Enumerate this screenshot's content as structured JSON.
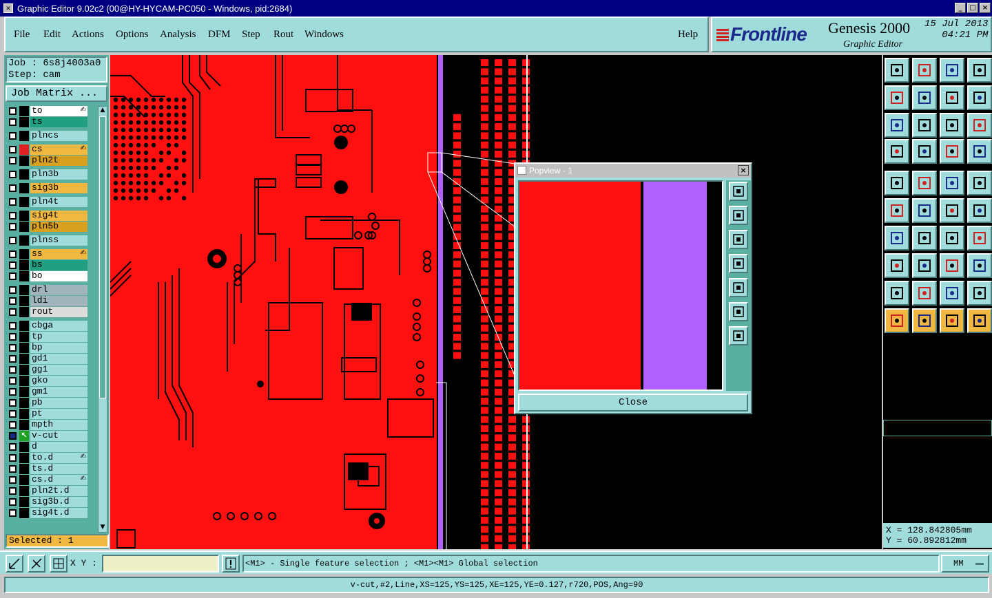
{
  "window": {
    "title": "Graphic Editor 9.02c2 (00@HY-HYCAM-PC050 - Windows, pid:2684)"
  },
  "menu": [
    "File",
    "Edit",
    "Actions",
    "Options",
    "Analysis",
    "DFM",
    "Step",
    "Rout",
    "Windows"
  ],
  "help": "Help",
  "brand": {
    "logo": "Frontline",
    "product": "Genesis 2000",
    "subtitle": "Graphic Editor",
    "date": "15 Jul 2013",
    "time": "04:21 PM"
  },
  "job": {
    "label": "Job : 6s8j4003a0",
    "step": "Step: cam",
    "matrix_button": "Job Matrix ..."
  },
  "layers": [
    {
      "name": "to",
      "color": "#ffffff",
      "swatch": "#000000",
      "affected": true
    },
    {
      "name": "ts",
      "color": "#20a080",
      "swatch": "#000000"
    },
    {
      "name": "plncs",
      "color": "#a0dcdc",
      "swatch": "#000000"
    },
    {
      "name": "cs",
      "color": "#f0b840",
      "swatch": "#e02020",
      "affected": true
    },
    {
      "name": "pln2t",
      "color": "#d8a020",
      "swatch": "#000000"
    },
    {
      "name": "pln3b",
      "color": "#a0dcdc",
      "swatch": "#000000"
    },
    {
      "name": "sig3b",
      "color": "#f0b840",
      "swatch": "#000000"
    },
    {
      "name": "pln4t",
      "color": "#a0dcdc",
      "swatch": "#000000"
    },
    {
      "name": "sig4t",
      "color": "#f0b840",
      "swatch": "#000000"
    },
    {
      "name": "pln5b",
      "color": "#d8a020",
      "swatch": "#000000"
    },
    {
      "name": "plnss",
      "color": "#a0dcdc",
      "swatch": "#000000"
    },
    {
      "name": "ss",
      "color": "#f0b840",
      "swatch": "#000000",
      "affected": true
    },
    {
      "name": "bs",
      "color": "#20a080",
      "swatch": "#000000"
    },
    {
      "name": "bo",
      "color": "#ffffff",
      "swatch": "#000000"
    },
    {
      "name": "drl",
      "color": "#a0b4bc",
      "swatch": "#000000"
    },
    {
      "name": "ldi",
      "color": "#a0b4bc",
      "swatch": "#000000"
    },
    {
      "name": "rout",
      "color": "#dcdcdc",
      "swatch": "#000000"
    },
    {
      "name": "cbga",
      "color": "#a0dcdc",
      "swatch": "#000000"
    },
    {
      "name": "tp",
      "color": "#a0dcdc",
      "swatch": "#000000"
    },
    {
      "name": "bp",
      "color": "#a0dcdc",
      "swatch": "#000000"
    },
    {
      "name": "gd1",
      "color": "#a0dcdc",
      "swatch": "#000000"
    },
    {
      "name": "gg1",
      "color": "#a0dcdc",
      "swatch": "#000000"
    },
    {
      "name": "gko",
      "color": "#a0dcdc",
      "swatch": "#000000"
    },
    {
      "name": "gm1",
      "color": "#a0dcdc",
      "swatch": "#000000"
    },
    {
      "name": "pb",
      "color": "#a0dcdc",
      "swatch": "#000000"
    },
    {
      "name": "pt",
      "color": "#a0dcdc",
      "swatch": "#000000"
    },
    {
      "name": "mpth",
      "color": "#a0dcdc",
      "swatch": "#000000"
    },
    {
      "name": "v-cut",
      "color": "#a0dcdc",
      "swatch": "#20a020",
      "work": true
    },
    {
      "name": "d",
      "color": "#a0dcdc",
      "swatch": "#000000"
    },
    {
      "name": "to.d",
      "color": "#a0dcdc",
      "swatch": "#000000",
      "affected": true
    },
    {
      "name": "ts.d",
      "color": "#a0dcdc",
      "swatch": "#000000"
    },
    {
      "name": "cs.d",
      "color": "#a0dcdc",
      "swatch": "#000000",
      "affected": true
    },
    {
      "name": "pln2t.d",
      "color": "#a0dcdc",
      "swatch": "#000000"
    },
    {
      "name": "sig3b.d",
      "color": "#a0dcdc",
      "swatch": "#000000"
    },
    {
      "name": "sig4t.d",
      "color": "#a0dcdc",
      "swatch": "#000000"
    }
  ],
  "selected": "Selected : 1",
  "popview": {
    "title": "Popview - 1",
    "close": "Close"
  },
  "coords": {
    "x": "X = 128.842805mm",
    "y": "Y = 60.892812mm"
  },
  "bottom": {
    "xy_label": "X Y :",
    "xy_value": "",
    "hint": "<M1> - Single feature selection ; <M1><M1> Global selection",
    "units": "MM"
  },
  "status": "v-cut,#2,Line,XS=125,YS=125,XE=125,YE=0.127,r720,POS,Ang=90",
  "colors": {
    "board_red": "#ff1010",
    "vcut_purple": "#b060ff",
    "panel_teal": "#a0dcdc",
    "highlight": "#f0b840"
  }
}
